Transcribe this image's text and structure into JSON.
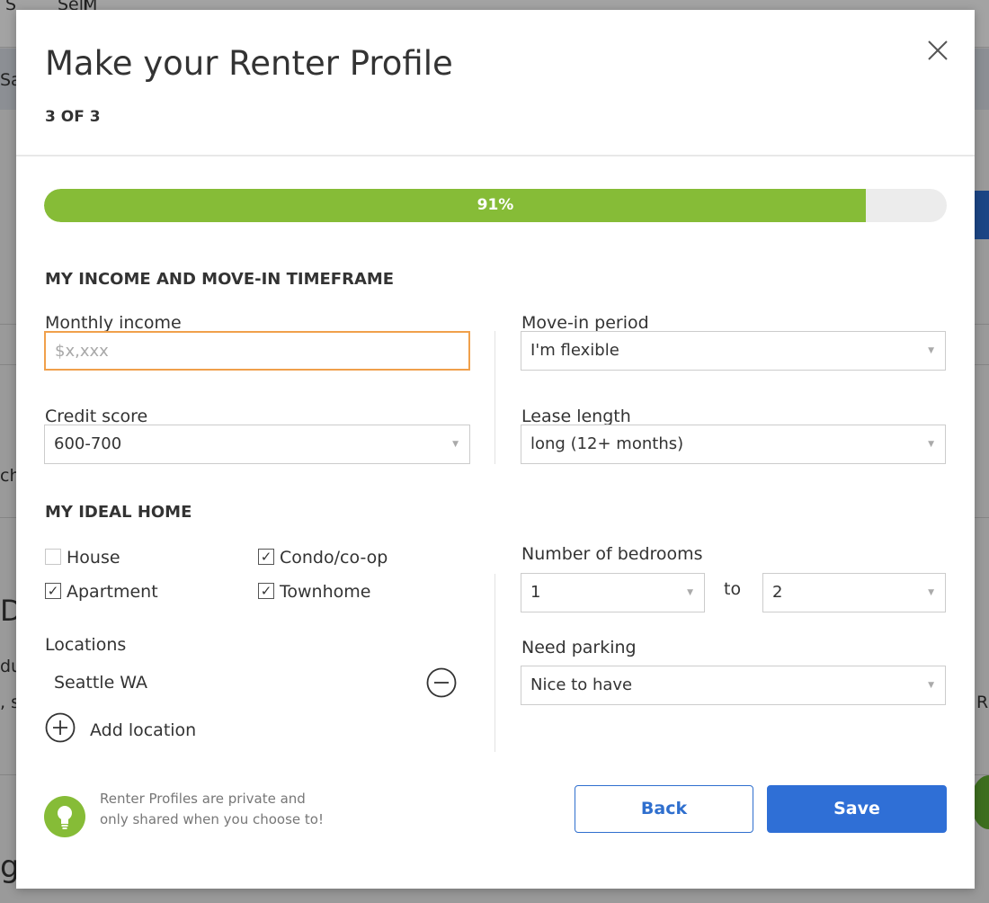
{
  "modal": {
    "title": "Make your Renter Profile",
    "step": "3 OF 3",
    "progress": {
      "percent": 91,
      "label": "91%"
    }
  },
  "income_section": {
    "heading": "MY INCOME AND MOVE-IN TIMEFRAME",
    "monthly_income": {
      "label": "Monthly income",
      "placeholder": "$x,xxx",
      "value": ""
    },
    "move_in_period": {
      "label": "Move-in period",
      "value": "I'm flexible"
    },
    "credit_score": {
      "label": "Credit score",
      "value": "600-700"
    },
    "lease_length": {
      "label": "Lease length",
      "value": "long (12+ months)"
    }
  },
  "home_section": {
    "heading": "MY IDEAL HOME",
    "home_types": [
      {
        "label": "House",
        "checked": false
      },
      {
        "label": "Condo/co-op",
        "checked": true
      },
      {
        "label": "Apartment",
        "checked": true
      },
      {
        "label": "Townhome",
        "checked": true
      }
    ],
    "bedrooms": {
      "label": "Number of bedrooms",
      "min": "1",
      "separator": "to",
      "max": "2"
    },
    "parking": {
      "label": "Need parking",
      "value": "Nice to have"
    },
    "locations": {
      "label": "Locations",
      "items": [
        "Seattle WA"
      ],
      "add_label": "Add location"
    }
  },
  "tip": {
    "line1": "Renter Profiles are private and",
    "line2": "only shared when you choose to!"
  },
  "actions": {
    "back": "Back",
    "save": "Save"
  },
  "colors": {
    "accent_blue": "#2f6fd6",
    "progress_green": "#86bc37",
    "focus_orange": "#f0a04b"
  }
}
